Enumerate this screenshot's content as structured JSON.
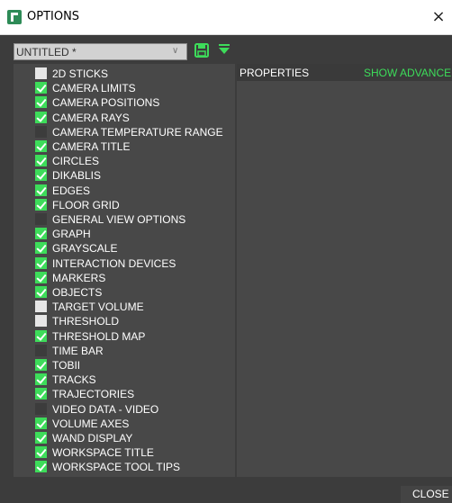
{
  "window": {
    "title": "OPTIONS",
    "close_glyph": "×"
  },
  "toolbar": {
    "preset_value": "UNTITLED *",
    "preset_chevron": "∨",
    "save_icon": "save-icon",
    "filter_icon": "filter-icon"
  },
  "colors": {
    "accent_green": "#3ddc5a",
    "panel_bg": "#484848",
    "window_bg": "#3c3c3c"
  },
  "options": [
    {
      "label": "2D STICKS",
      "state": "white"
    },
    {
      "label": "CAMERA LIMITS",
      "state": "checked"
    },
    {
      "label": "CAMERA POSITIONS",
      "state": "checked"
    },
    {
      "label": "CAMERA RAYS",
      "state": "checked"
    },
    {
      "label": "CAMERA TEMPERATURE RANGE",
      "state": "dark"
    },
    {
      "label": "CAMERA TITLE",
      "state": "checked"
    },
    {
      "label": "CIRCLES",
      "state": "checked"
    },
    {
      "label": "DIKABLIS",
      "state": "checked"
    },
    {
      "label": "EDGES",
      "state": "checked"
    },
    {
      "label": "FLOOR GRID",
      "state": "checked"
    },
    {
      "label": "GENERAL VIEW OPTIONS",
      "state": "dark"
    },
    {
      "label": "GRAPH",
      "state": "checked"
    },
    {
      "label": "GRAYSCALE",
      "state": "checked"
    },
    {
      "label": "INTERACTION DEVICES",
      "state": "checked"
    },
    {
      "label": "MARKERS",
      "state": "checked"
    },
    {
      "label": "OBJECTS",
      "state": "checked"
    },
    {
      "label": "TARGET VOLUME",
      "state": "white"
    },
    {
      "label": "THRESHOLD",
      "state": "white"
    },
    {
      "label": "THRESHOLD MAP",
      "state": "checked"
    },
    {
      "label": "TIME BAR",
      "state": "dark"
    },
    {
      "label": "TOBII",
      "state": "checked"
    },
    {
      "label": "TRACKS",
      "state": "checked"
    },
    {
      "label": "TRAJECTORIES",
      "state": "checked"
    },
    {
      "label": "VIDEO DATA - VIDEO",
      "state": "dark"
    },
    {
      "label": "VOLUME AXES",
      "state": "checked"
    },
    {
      "label": "WAND DISPLAY",
      "state": "checked"
    },
    {
      "label": "WORKSPACE TITLE",
      "state": "checked"
    },
    {
      "label": "WORKSPACE TOOL TIPS",
      "state": "checked"
    }
  ],
  "properties": {
    "title": "PROPERTIES",
    "show_advanced": "SHOW ADVANCED"
  },
  "footer": {
    "close_label": "CLOSE"
  }
}
